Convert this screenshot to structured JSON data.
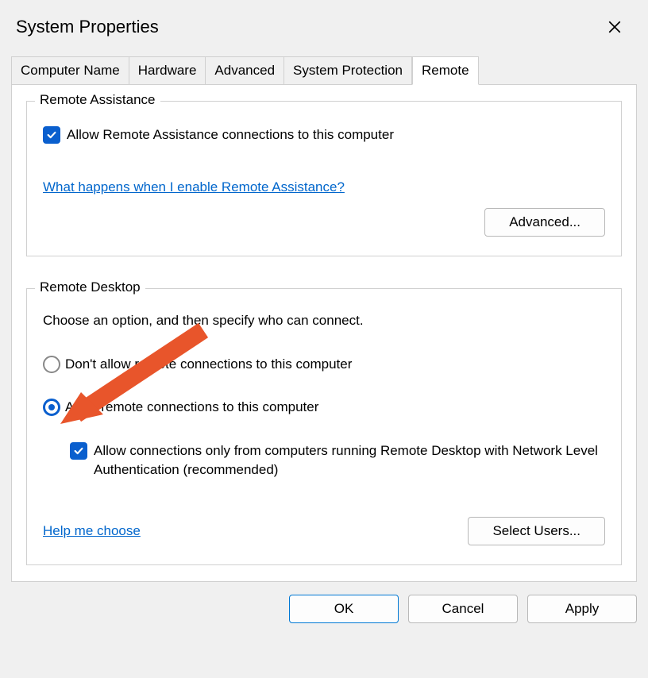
{
  "window": {
    "title": "System Properties"
  },
  "tabs": [
    {
      "label": "Computer Name"
    },
    {
      "label": "Hardware"
    },
    {
      "label": "Advanced"
    },
    {
      "label": "System Protection"
    },
    {
      "label": "Remote",
      "active": true
    }
  ],
  "remote_assistance": {
    "legend": "Remote Assistance",
    "allow_label": "Allow Remote Assistance connections to this computer",
    "help_link": "What happens when I enable Remote Assistance?",
    "advanced_button": "Advanced..."
  },
  "remote_desktop": {
    "legend": "Remote Desktop",
    "instruction": "Choose an option, and then specify who can connect.",
    "option_deny": "Don't allow remote connections to this computer",
    "option_allow": "Allow remote connections to this computer",
    "nla_label": "Allow connections only from computers running Remote Desktop with Network Level Authentication (recommended)",
    "help_link": "Help me choose",
    "select_users_button": "Select Users..."
  },
  "buttons": {
    "ok": "OK",
    "cancel": "Cancel",
    "apply": "Apply"
  }
}
